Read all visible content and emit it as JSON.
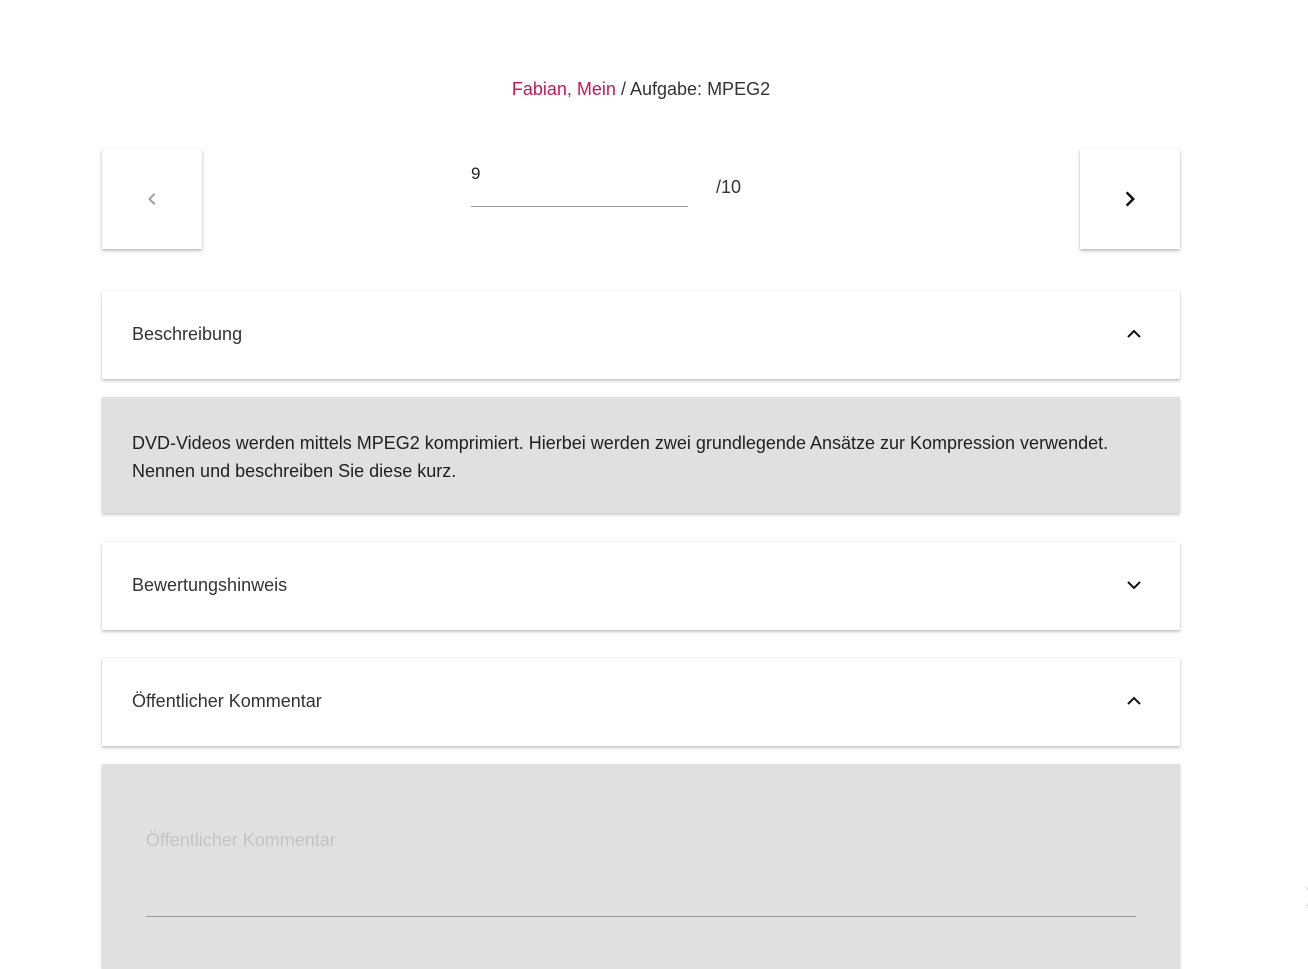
{
  "breadcrumb": {
    "student": "Fabian, Mein",
    "separator": "/",
    "task": "Aufgabe: MPEG2"
  },
  "navigation": {
    "prev_icon": "chevron-left-icon",
    "next_icon": "chevron-right-icon",
    "points_value": "9",
    "points_total": "/10"
  },
  "panels": {
    "description": {
      "title": "Beschreibung",
      "expanded": true,
      "text": "DVD-Videos werden mittels MPEG2 komprimiert. Hierbei werden zwei grundlegende Ansätze zur Kompression verwendet. Nennen und beschreiben Sie diese kurz."
    },
    "grading_hint": {
      "title": "Bewertungshinweis",
      "expanded": false
    },
    "public_comment": {
      "title": "Öffentlicher Kommentar",
      "expanded": true,
      "placeholder": "Öffentlicher Kommentar",
      "value": ""
    }
  },
  "colors": {
    "accent": "#c2185b",
    "panel_body_bg": "#e0e0e0"
  }
}
